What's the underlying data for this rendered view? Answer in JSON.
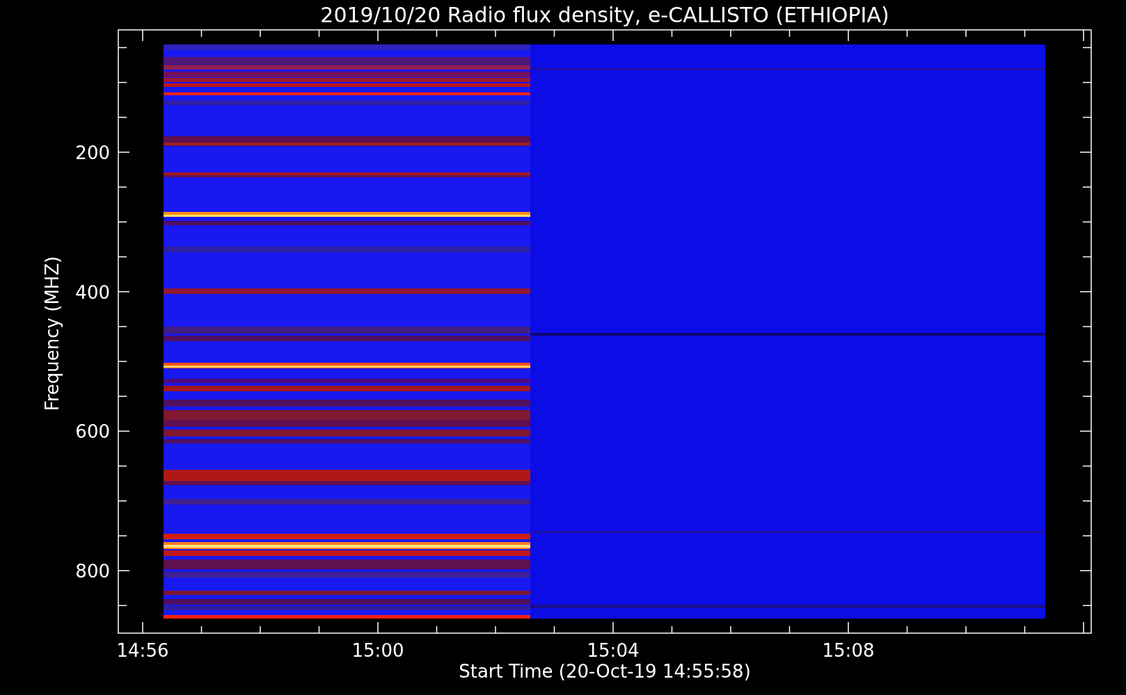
{
  "plot": {
    "title": "2019/10/20  Radio flux density, e-CALLISTO (ETHIOPIA)",
    "ylabel": "Frequency (MHZ)",
    "xlabel": "Start Time (20-Oct-19 14:55:58)",
    "yticks": [
      "200",
      "400",
      "600",
      "800"
    ],
    "xticks": [
      "14:56",
      "15:00",
      "15:04",
      "15:08"
    ]
  }
}
